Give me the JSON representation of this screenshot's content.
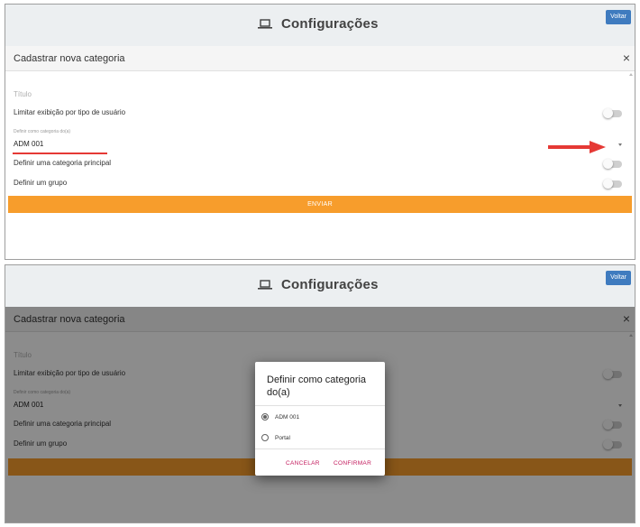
{
  "header": {
    "title": "Configurações",
    "back_label": "Voltar"
  },
  "dialog": {
    "title": "Cadastrar nova categoria",
    "close_glyph": "×"
  },
  "form": {
    "titulo_placeholder": "Título",
    "limitar_label": "Limitar exibição por tipo de usuário",
    "categoria_caption": "Definir como categoria do(a)",
    "categoria_value": "ADM 001",
    "principal_label": "Definir uma categoria principal",
    "grupo_label": "Definir um grupo",
    "submit_label": "ENVIAR"
  },
  "modal": {
    "title": "Definir como categoria do(a)",
    "options": [
      {
        "label": "ADM 001",
        "selected": true
      },
      {
        "label": "Portal",
        "selected": false
      }
    ],
    "cancel_label": "CANCELAR",
    "confirm_label": "CONFIRMAR"
  },
  "colors": {
    "accent_orange": "#f79d2c",
    "voltar_blue": "#3f7bbf",
    "annotation_red": "#e53935",
    "modal_button_pink": "#c2185b"
  },
  "icons": {
    "header": "laptop-icon",
    "annotation": "red-arrow-icon"
  }
}
